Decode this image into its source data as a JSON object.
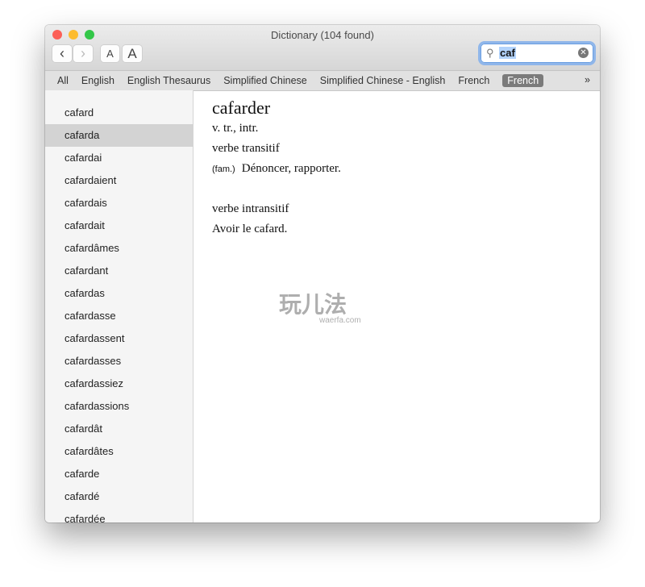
{
  "window": {
    "title": "Dictionary (104 found)",
    "traffic_colors": [
      "#fc5f57",
      "#fdbc2e",
      "#33c748"
    ]
  },
  "toolbar": {
    "back": "‹",
    "forward": "›",
    "font_smaller": "A",
    "font_larger": "A"
  },
  "search": {
    "value": "caf",
    "icon": "search-icon",
    "clear_icon": "clear-icon"
  },
  "tabs": [
    {
      "label": "All"
    },
    {
      "label": "English"
    },
    {
      "label": "English Thesaurus"
    },
    {
      "label": "Simplified Chinese"
    },
    {
      "label": "Simplified Chinese - English"
    },
    {
      "label": "French"
    },
    {
      "label": "French",
      "selected": true
    }
  ],
  "tabs_more": "»",
  "results": [
    "cafard",
    "cafarda",
    "cafardai",
    "cafardaient",
    "cafardais",
    "cafardait",
    "cafardâmes",
    "cafardant",
    "cafardas",
    "cafardasse",
    "cafardassent",
    "cafardasses",
    "cafardassiez",
    "cafardassions",
    "cafardât",
    "cafardâtes",
    "cafarde",
    "cafardé",
    "cafardée"
  ],
  "selected_result": "cafarda",
  "entry": {
    "headword": "cafarder",
    "pos": "v. tr., intr.",
    "sense1_label": "verbe transitif",
    "sense1_register": "(fam.)",
    "sense1_def": "Dénoncer, rapporter.",
    "sense2_label": "verbe intransitif",
    "sense2_def": "Avoir le cafard."
  },
  "watermark": {
    "text": "玩儿法",
    "url": "waerfa.com"
  }
}
